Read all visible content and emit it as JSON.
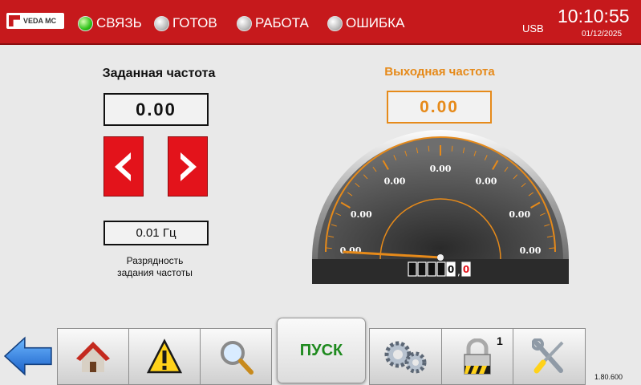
{
  "header": {
    "logo_text": "VEDA MC",
    "indicators": [
      {
        "label": "СВЯЗЬ",
        "state": "green"
      },
      {
        "label": "ГОТОВ",
        "state": "gray"
      },
      {
        "label": "РАБОТА",
        "state": "gray"
      },
      {
        "label": "ОШИБКА",
        "state": "gray"
      }
    ],
    "usb_label": "USB",
    "time": "10:10:55",
    "date": "01/12/2025"
  },
  "setpoint": {
    "title": "Заданная частота",
    "value": "0.00",
    "step_value": "0.01 Гц",
    "step_caption_line1": "Разрядность",
    "step_caption_line2": "задания частоты"
  },
  "output": {
    "title": "Выходная частота",
    "value": "0.00"
  },
  "gauge": {
    "scale_labels": [
      "0.00",
      "0.00",
      "0.00",
      "0.00",
      "0.00",
      "0.00",
      "0.00"
    ],
    "needle_value": 0,
    "odometer_integer": "0",
    "odometer_fraction": "0"
  },
  "nav": {
    "start_label": "ПУСК",
    "lock_level": "1",
    "version": "1.80.600"
  },
  "colors": {
    "header_bg": "#c6191c",
    "accent_orange": "#e68a1a",
    "arrow_button_red": "#e3131b",
    "start_text_green": "#1f8a1f"
  },
  "icons": [
    "back-arrow-icon",
    "home-icon",
    "warning-icon",
    "search-icon",
    "gears-icon",
    "lock-icon",
    "tools-icon"
  ]
}
